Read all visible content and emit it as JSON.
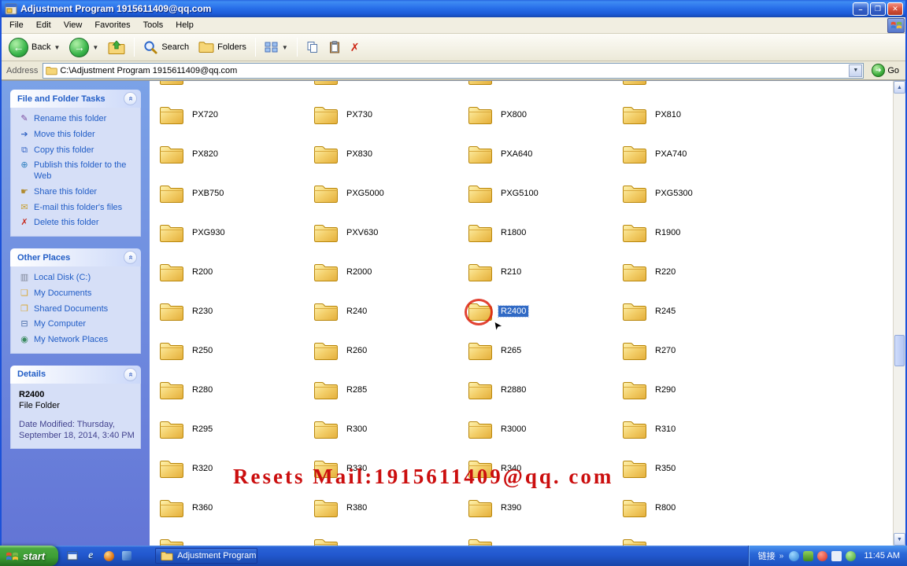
{
  "window": {
    "title": "Adjustment Program 1915611409@qq.com",
    "controls": {
      "minimize": "–",
      "maximize": "❐",
      "close": "✕"
    }
  },
  "menubar": {
    "items": [
      "File",
      "Edit",
      "View",
      "Favorites",
      "Tools",
      "Help"
    ]
  },
  "toolbar": {
    "back": "Back",
    "search": "Search",
    "folders": "Folders"
  },
  "addressbar": {
    "label": "Address",
    "path": "C:\\Adjustment Program 1915611409@qq.com",
    "go": "Go"
  },
  "sidebar": {
    "file_folder_tasks": {
      "title": "File and Folder Tasks",
      "items": [
        {
          "label": "Rename this folder",
          "icon": "rename"
        },
        {
          "label": "Move this folder",
          "icon": "move"
        },
        {
          "label": "Copy this folder",
          "icon": "copy"
        },
        {
          "label": "Publish this folder to the Web",
          "icon": "publish"
        },
        {
          "label": "Share this folder",
          "icon": "share"
        },
        {
          "label": "E-mail this folder's files",
          "icon": "email"
        },
        {
          "label": "Delete this folder",
          "icon": "delete"
        }
      ]
    },
    "other_places": {
      "title": "Other Places",
      "items": [
        {
          "label": "Local Disk (C:)",
          "icon": "disk"
        },
        {
          "label": "My Documents",
          "icon": "mydocs"
        },
        {
          "label": "Shared Documents",
          "icon": "shareddocs"
        },
        {
          "label": "My Computer",
          "icon": "computer"
        },
        {
          "label": "My Network Places",
          "icon": "network"
        }
      ]
    },
    "details": {
      "title": "Details",
      "name": "R2400",
      "type": "File Folder",
      "modified_line1": "Date Modified: Thursday,",
      "modified_line2": "September 18, 2014, 3:40 PM"
    }
  },
  "folders": {
    "items": [
      {
        "name": "",
        "partial": true
      },
      {
        "name": "",
        "partial": true
      },
      {
        "name": "",
        "partial": true
      },
      {
        "name": "",
        "partial": true
      },
      {
        "name": "PX720"
      },
      {
        "name": "PX730"
      },
      {
        "name": "PX800"
      },
      {
        "name": "PX810"
      },
      {
        "name": "PX820"
      },
      {
        "name": "PX830"
      },
      {
        "name": "PXA640"
      },
      {
        "name": "PXA740"
      },
      {
        "name": "PXB750"
      },
      {
        "name": "PXG5000"
      },
      {
        "name": "PXG5100"
      },
      {
        "name": "PXG5300"
      },
      {
        "name": "PXG930"
      },
      {
        "name": "PXV630"
      },
      {
        "name": "R1800"
      },
      {
        "name": "R1900"
      },
      {
        "name": "R200"
      },
      {
        "name": "R2000"
      },
      {
        "name": "R210"
      },
      {
        "name": "R220"
      },
      {
        "name": "R230"
      },
      {
        "name": "R240"
      },
      {
        "name": "R2400",
        "selected": true
      },
      {
        "name": "R245"
      },
      {
        "name": "R250"
      },
      {
        "name": "R260"
      },
      {
        "name": "R265"
      },
      {
        "name": "R270"
      },
      {
        "name": "R280"
      },
      {
        "name": "R285"
      },
      {
        "name": "R2880"
      },
      {
        "name": "R290"
      },
      {
        "name": "R295"
      },
      {
        "name": "R300"
      },
      {
        "name": "R3000"
      },
      {
        "name": "R310"
      },
      {
        "name": "R320"
      },
      {
        "name": "R330"
      },
      {
        "name": "R340"
      },
      {
        "name": "R350"
      },
      {
        "name": "R360"
      },
      {
        "name": "R380"
      },
      {
        "name": "R390"
      },
      {
        "name": "R800"
      },
      {
        "name": "",
        "partial": true
      },
      {
        "name": "",
        "partial": true
      },
      {
        "name": "",
        "partial": true
      },
      {
        "name": "",
        "partial": true
      }
    ]
  },
  "watermark": "Resets Mail:1915611409@qq. com",
  "taskbar": {
    "start": "start",
    "task_button": "Adjustment Program ...",
    "tray_links": "链接",
    "time": "11:45 AM"
  }
}
